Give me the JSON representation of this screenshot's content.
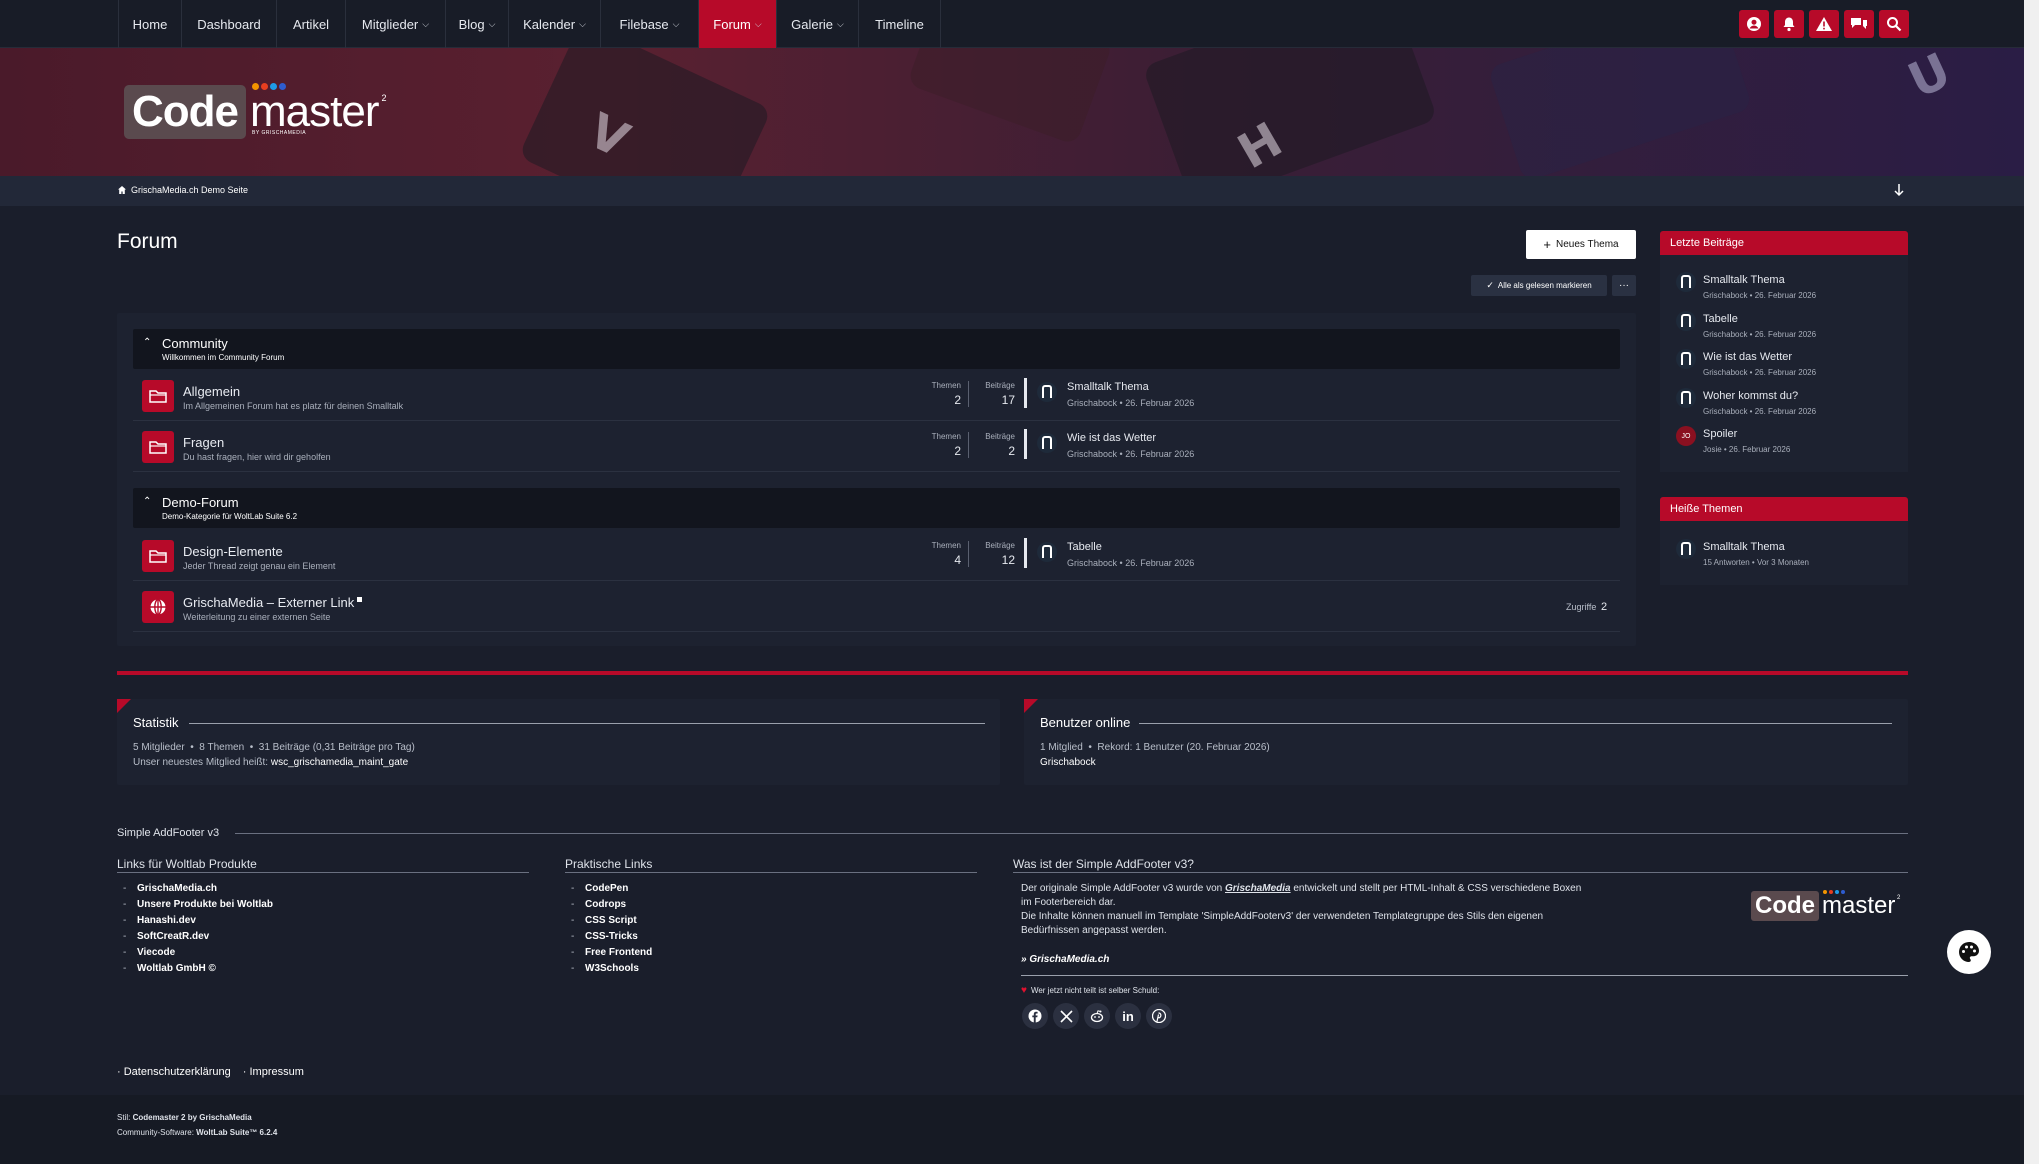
{
  "nav": {
    "items": [
      {
        "label": "Home",
        "dropdown": false
      },
      {
        "label": "Dashboard",
        "dropdown": false
      },
      {
        "label": "Artikel",
        "dropdown": false
      },
      {
        "label": "Mitglieder",
        "dropdown": true
      },
      {
        "label": "Blog",
        "dropdown": true
      },
      {
        "label": "Kalender",
        "dropdown": true
      },
      {
        "label": "Filebase",
        "dropdown": true
      },
      {
        "label": "Forum",
        "dropdown": true,
        "active": true
      },
      {
        "label": "Galerie",
        "dropdown": true
      },
      {
        "label": "Timeline",
        "dropdown": false
      }
    ],
    "icons": [
      "user-icon",
      "bell-icon",
      "warning-icon",
      "conversations-icon",
      "search-icon"
    ]
  },
  "logo": {
    "code": "Code",
    "master": "master",
    "superscript": "2",
    "tagline": "BY GRISCHAMEDIA"
  },
  "breadcrumb": {
    "label": "GrischaMedia.ch Demo Seite"
  },
  "main": {
    "title": "Forum",
    "new_topic": "Neues Thema",
    "mark_read": "Alle als gelesen markieren",
    "more": "···"
  },
  "categories": [
    {
      "title": "Community",
      "desc": "Willkommen im Community Forum",
      "boards": [
        {
          "title": "Allgemein",
          "desc": "Im Allgemeinen Forum hat es platz für deinen Smalltalk",
          "topics_label": "Themen",
          "topics": "2",
          "posts_label": "Beiträge",
          "posts": "17",
          "last_title": "Smalltalk Thema",
          "last_author": "Grischabock",
          "last_date": "26. Februar 2026"
        },
        {
          "title": "Fragen",
          "desc": "Du hast fragen, hier wird dir geholfen",
          "topics_label": "Themen",
          "topics": "2",
          "posts_label": "Beiträge",
          "posts": "2",
          "last_title": "Wie ist das Wetter",
          "last_author": "Grischabock",
          "last_date": "26. Februar 2026"
        }
      ]
    },
    {
      "title": "Demo-Forum",
      "desc": "Demo-Kategorie für WoltLab Suite 6.2",
      "boards": [
        {
          "title": "Design-Elemente",
          "desc": "Jeder Thread zeigt genau ein Element",
          "topics_label": "Themen",
          "topics": "4",
          "posts_label": "Beiträge",
          "posts": "12",
          "last_title": "Tabelle",
          "last_author": "Grischabock",
          "last_date": "26. Februar 2026"
        }
      ],
      "link": {
        "title": "GrischaMedia – Externer Link",
        "desc": "Weiterleitung zu einer externen Seite",
        "hits_label": "Zugriffe",
        "hits": "2"
      }
    }
  ],
  "sidebar": {
    "latest": {
      "title": "Letzte Beiträge",
      "items": [
        {
          "title": "Smalltalk Thema",
          "meta": "Grischabock • 26. Februar 2026",
          "avatar": ""
        },
        {
          "title": "Tabelle",
          "meta": "Grischabock • 26. Februar 2026",
          "avatar": ""
        },
        {
          "title": "Wie ist das Wetter",
          "meta": "Grischabock • 26. Februar 2026",
          "avatar": ""
        },
        {
          "title": "Woher kommst du?",
          "meta": "Grischabock • 26. Februar 2026",
          "avatar": ""
        },
        {
          "title": "Spoiler",
          "meta": "Josie • 26. Februar 2026",
          "avatar": "JO"
        }
      ]
    },
    "hot": {
      "title": "Heiße Themen",
      "items": [
        {
          "title": "Smalltalk Thema",
          "meta": "15 Antworten • Vor 3 Monaten"
        }
      ]
    }
  },
  "stats": {
    "title": "Statistik",
    "line1": "5 Mitglieder  •  8 Themen  •  31 Beiträge (0,31 Beiträge pro Tag)",
    "line2_prefix": "Unser neuestes Mitglied heißt: ",
    "newest": "wsc_grischamedia_maint_gate"
  },
  "online": {
    "title": "Benutzer online",
    "line1": "1 Mitglied  •  Rekord: 1 Benutzer (20. Februar 2026)",
    "user": "Grischabock"
  },
  "addfooter": {
    "title": "Simple AddFooter v3",
    "col1": {
      "title": "Links für Woltlab Produkte",
      "links": [
        "GrischaMedia.ch",
        "Unsere Produkte bei Woltlab",
        "Hanashi.dev",
        "SoftCreatR.dev",
        "Viecode",
        "Woltlab GmbH ©"
      ]
    },
    "col2": {
      "title": "Praktische Links",
      "links": [
        "CodePen",
        "Codrops",
        "CSS Script",
        "CSS-Tricks",
        "Free Frontend",
        "W3Schools"
      ]
    },
    "col3": {
      "title": "Was ist der Simple AddFooter v3?",
      "p1a": "Der originale Simple AddFooter v3 wurde von ",
      "p1b": "GrischaMedia",
      "p1c": " entwickelt und stellt per HTML-Inhalt & CSS verschiedene Boxen im Footerbereich dar.",
      "p2": "Die Inhalte können manuell im Template 'SimpleAddFooterv3' der verwendeten Templategruppe des Stils den eigenen Bedürfnissen angepasst werden.",
      "link": "» GrischaMedia.ch",
      "share": "Wer jetzt nicht teilt ist selber Schuld:"
    }
  },
  "footer": {
    "links": [
      "Datenschutzerklärung",
      "Impressum"
    ],
    "style_prefix": "Stil: ",
    "style": "Codemaster 2 by GrischaMedia",
    "software_prefix": "Community-Software: ",
    "software": "WoltLab Suite™ 6.2.4"
  },
  "colors": {
    "accent": "#b70a29",
    "bg": "#1a1e2b",
    "panel": "#1d2230"
  }
}
